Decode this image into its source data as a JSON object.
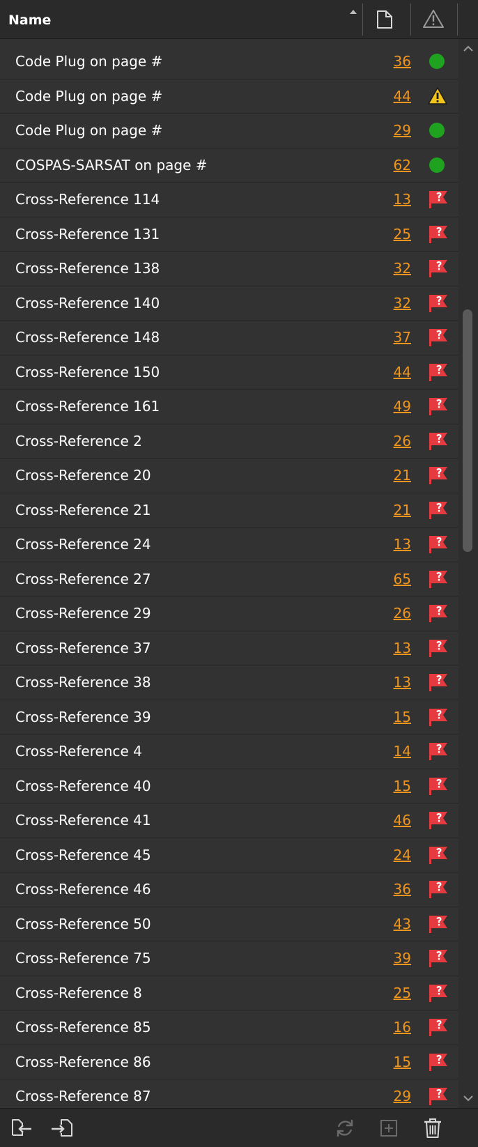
{
  "header": {
    "name_label": "Name",
    "page_icon": "page-icon",
    "warning_icon": "warning-icon"
  },
  "colors": {
    "background": "#323232",
    "page_link": "#f0961e",
    "ok": "#1fa21f",
    "warning": "#f2c31b",
    "error": "#e53a3f"
  },
  "rows": [
    {
      "name": "Code Plug on page #",
      "page": "36",
      "status": "ok"
    },
    {
      "name": "Code Plug on page #",
      "page": "44",
      "status": "warning"
    },
    {
      "name": "Code Plug on page #",
      "page": "29",
      "status": "ok"
    },
    {
      "name": "COSPAS-SARSAT on page #",
      "page": "62",
      "status": "ok"
    },
    {
      "name": "Cross-Reference 114",
      "page": "13",
      "status": "error"
    },
    {
      "name": "Cross-Reference 131",
      "page": "25",
      "status": "error"
    },
    {
      "name": "Cross-Reference 138",
      "page": "32",
      "status": "error"
    },
    {
      "name": "Cross-Reference 140",
      "page": "32",
      "status": "error"
    },
    {
      "name": "Cross-Reference 148",
      "page": "37",
      "status": "error"
    },
    {
      "name": "Cross-Reference 150",
      "page": "44",
      "status": "error"
    },
    {
      "name": "Cross-Reference 161",
      "page": "49",
      "status": "error"
    },
    {
      "name": "Cross-Reference 2",
      "page": "26",
      "status": "error"
    },
    {
      "name": "Cross-Reference 20",
      "page": "21",
      "status": "error"
    },
    {
      "name": "Cross-Reference 21",
      "page": "21",
      "status": "error"
    },
    {
      "name": "Cross-Reference 24",
      "page": "13",
      "status": "error"
    },
    {
      "name": "Cross-Reference 27",
      "page": "65",
      "status": "error"
    },
    {
      "name": "Cross-Reference 29",
      "page": "26",
      "status": "error"
    },
    {
      "name": "Cross-Reference 37",
      "page": "13",
      "status": "error"
    },
    {
      "name": "Cross-Reference 38",
      "page": "13",
      "status": "error"
    },
    {
      "name": "Cross-Reference 39",
      "page": "15",
      "status": "error"
    },
    {
      "name": "Cross-Reference 4",
      "page": "14",
      "status": "error"
    },
    {
      "name": "Cross-Reference 40",
      "page": "15",
      "status": "error"
    },
    {
      "name": "Cross-Reference 41",
      "page": "46",
      "status": "error"
    },
    {
      "name": "Cross-Reference 45",
      "page": "24",
      "status": "error"
    },
    {
      "name": "Cross-Reference 46",
      "page": "36",
      "status": "error"
    },
    {
      "name": "Cross-Reference 50",
      "page": "43",
      "status": "error"
    },
    {
      "name": "Cross-Reference 75",
      "page": "39",
      "status": "error"
    },
    {
      "name": "Cross-Reference 8",
      "page": "25",
      "status": "error"
    },
    {
      "name": "Cross-Reference 85",
      "page": "16",
      "status": "error"
    },
    {
      "name": "Cross-Reference 86",
      "page": "15",
      "status": "error"
    },
    {
      "name": "Cross-Reference 87",
      "page": "29",
      "status": "error"
    }
  ],
  "footer": {
    "tools": [
      {
        "icon": "export-icon",
        "enabled": true
      },
      {
        "icon": "import-icon",
        "enabled": true
      },
      {
        "icon": "refresh-icon",
        "enabled": false
      },
      {
        "icon": "add-icon",
        "enabled": false
      },
      {
        "icon": "trash-icon",
        "enabled": true
      }
    ]
  }
}
